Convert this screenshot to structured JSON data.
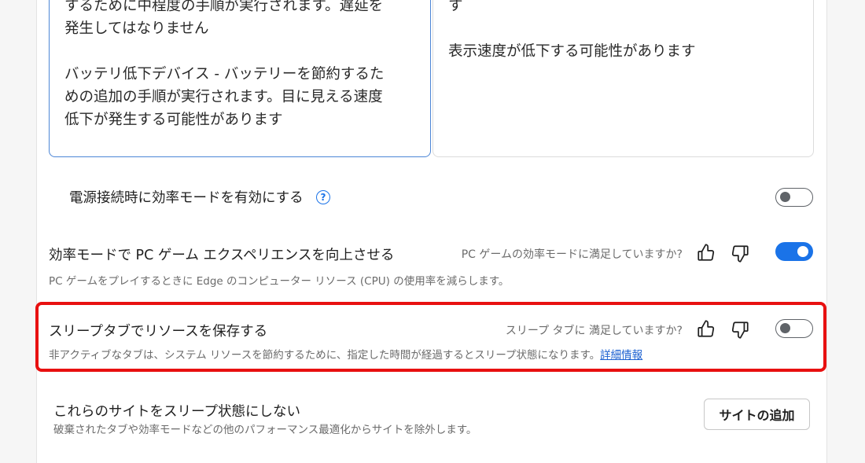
{
  "cards": {
    "left_text": "するために中程度の手順が実行されます。遅延を\n発生してはなりません\n\nバッテリ低下デバイス - バッテリーを節約するた\nめの追加の手順が実行されます。目に見える速度\n低下が発生する可能性があります",
    "right_text": "す\n\n表示速度が低下する可能性があります"
  },
  "settings": {
    "efficiency_plugged": {
      "title": "電源接続時に効率モードを有効にする",
      "help_icon": "help-circle-icon",
      "toggle_state": "off"
    },
    "pc_game": {
      "title": "効率モードで PC ゲーム エクスペリエンスを向上させる",
      "feedback_question": "PC ゲームの効率モードに満足していますか?",
      "description": "PC ゲームをプレイするときに Edge のコンピューター リソース (CPU) の使用率を減らします。",
      "toggle_state": "on"
    },
    "sleeping_tabs": {
      "title": "スリープタブでリソースを保存する",
      "feedback_question": "スリープ タブに 満足していますか?",
      "description": "非アクティブなタブは、システム リソースを節約するために、指定した時間が経過するとスリープ状態になります。",
      "link": "詳細情報",
      "toggle_state": "off"
    },
    "never_sleep": {
      "title": "これらのサイトをスリープ状態にしない",
      "description": "破棄されたタブや効率モードなどの他のパフォーマンス最適化からサイトを除外します。",
      "button": "サイトの追加"
    }
  },
  "icons": {
    "thumbs_up": "thumbs-up-icon",
    "thumbs_down": "thumbs-down-icon"
  },
  "colors": {
    "accent": "#1a73e8",
    "highlight": "#e81010"
  }
}
